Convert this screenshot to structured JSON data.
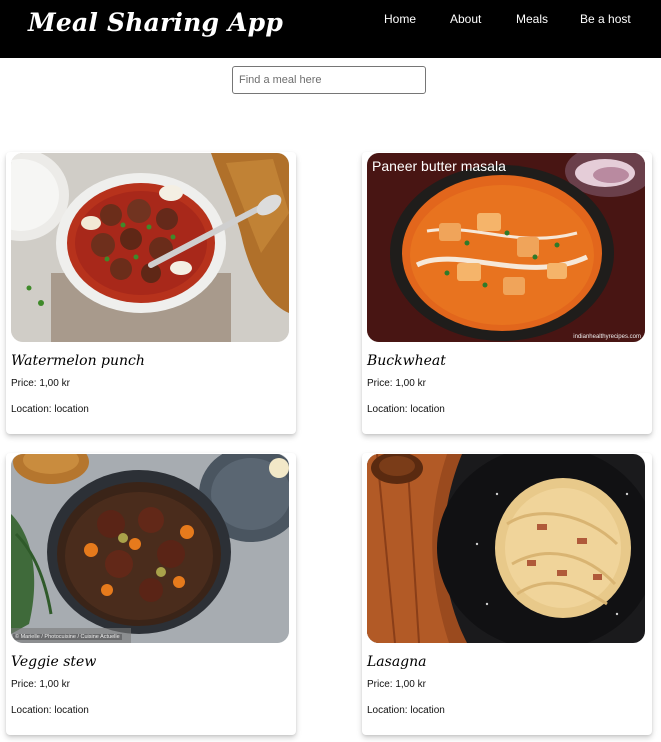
{
  "navbar": {
    "brand": "Meal Sharing App",
    "links": [
      "Home",
      "About",
      "Meals",
      "Be a host"
    ]
  },
  "search": {
    "placeholder": "Find a meal here",
    "value": ""
  },
  "meals": [
    {
      "title": "Watermelon punch",
      "price": "Price: 1,00 kr",
      "location": "Location: location",
      "photo_caption": "",
      "photo_credit": "",
      "image": "meatballs-in-tomato-sauce-skillet"
    },
    {
      "title": "Buckwheat",
      "price": "Price: 1,00 kr",
      "location": "Location: location",
      "photo_caption": "Paneer butter masala",
      "photo_credit": "indianhealthyrecipes.com",
      "image": "paneer-butter-masala-bowl"
    },
    {
      "title": "Veggie stew",
      "price": "Price: 1,00 kr",
      "location": "Location: location",
      "photo_caption": "",
      "photo_credit": "© Marielle / Photocuisine / Cuisine Actuelle",
      "image": "beef-stew-cast-iron-pot"
    },
    {
      "title": "Lasagna",
      "price": "Price: 1,00 kr",
      "location": "Location: location",
      "photo_caption": "",
      "photo_credit": "",
      "image": "spaghetti-carbonara-plate"
    }
  ]
}
